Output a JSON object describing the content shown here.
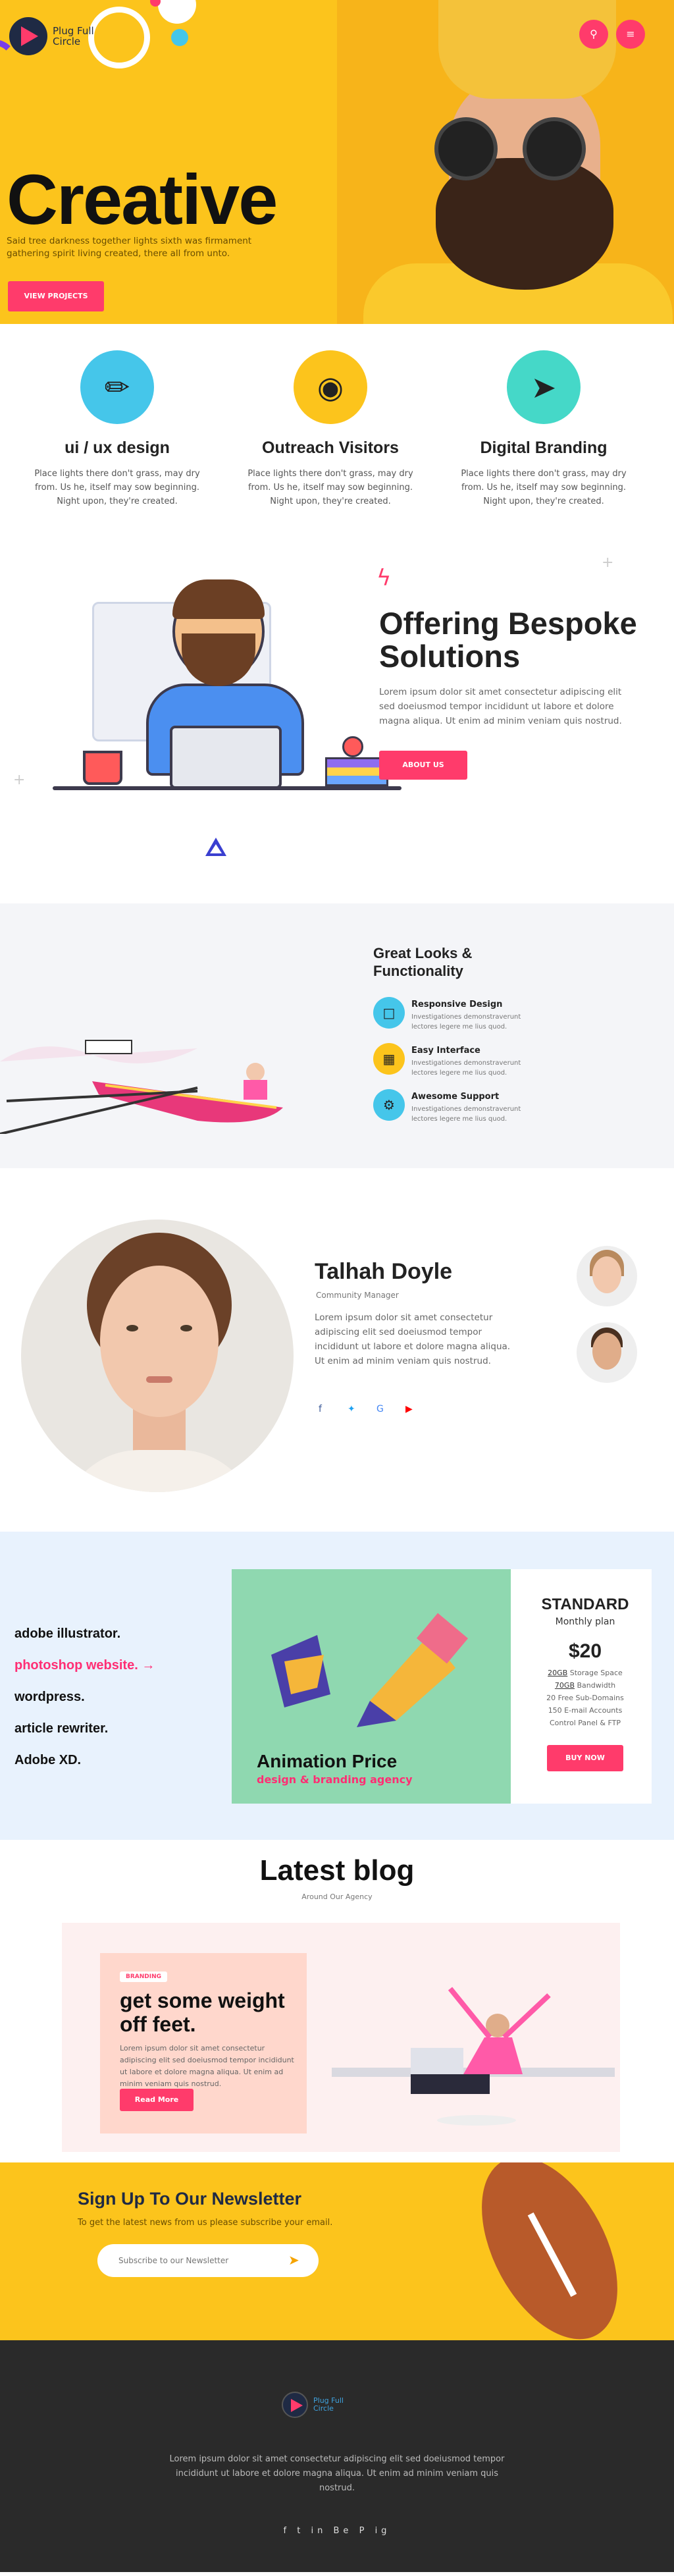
{
  "brand": {
    "name": "Plug Full Circle",
    "line1": "Plug Full",
    "line2": "Circle"
  },
  "colors": {
    "accent": "#ff3b6b",
    "yellow": "#fcc41c",
    "dark": "#2a2a2a"
  },
  "hero": {
    "title": "Creative",
    "subtitle": "Said tree darkness together lights sixth was firmament gathering spirit living created, there all from unto.",
    "button": "VIEW PROJECTS",
    "search_icon": "search-icon",
    "menu_icon": "menu-icon"
  },
  "services": [
    {
      "title": "ui / ux design",
      "text": "Place lights there don't grass, may dry from. Us he, itself may sow beginning. Night upon, they're created.",
      "icon": "brush-icon"
    },
    {
      "title": "Outreach Visitors",
      "text": "Place lights there don't grass, may dry from. Us he, itself may sow beginning. Night upon, they're created.",
      "icon": "camera-icon"
    },
    {
      "title": "Digital Branding",
      "text": "Place lights there don't grass, may dry from. Us he, itself may sow beginning. Night upon, they're created.",
      "icon": "paper-plane-icon"
    }
  ],
  "offering": {
    "title": "Offering Bespoke Solutions",
    "text": "Lorem ipsum dolor sit amet consectetur adipiscing elit sed doeiusmod tempor incididunt ut labore et dolore magna aliqua. Ut enim ad minim veniam quis nostrud.",
    "button": "ABOUT US"
  },
  "looks": {
    "title": "Great Looks & Functionality",
    "items": [
      {
        "title": "Responsive Design",
        "text": "Investigationes demonstraverunt lectores legere me lius quod.",
        "icon": "responsive-icon"
      },
      {
        "title": "Easy Interface",
        "text": "Investigationes demonstraverunt lectores legere me lius quod.",
        "icon": "interface-icon"
      },
      {
        "title": "Awesome Support",
        "text": "Investigationes demonstraverunt lectores legere me lius quod.",
        "icon": "support-icon"
      }
    ]
  },
  "team": {
    "name": "Talhah Doyle",
    "role": "Community Manager",
    "text": "Lorem ipsum dolor sit amet consectetur adipiscing elit sed doeiusmod tempor incididunt ut labore et dolore magna aliqua. Ut enim ad minim veniam quis nostrud.",
    "social": [
      "facebook-icon",
      "twitter-icon",
      "google-icon",
      "youtube-icon"
    ]
  },
  "pricing": {
    "list": [
      "adobe illustrator.",
      "photoshop website.",
      "wordpress.",
      "article rewriter.",
      "Adobe XD."
    ],
    "active_index": 1,
    "arrow": "→",
    "image_title": "Animation Price",
    "image_sub": "design & branding agency",
    "plan_name": "STANDARD",
    "plan_period": "Monthly plan",
    "price": "$20",
    "features": [
      {
        "bold": "20GB",
        "rest": " Storage Space"
      },
      {
        "bold": "70GB",
        "rest": " Bandwidth"
      },
      {
        "bold": "",
        "rest": "20 Free Sub-Domains"
      },
      {
        "bold": "",
        "rest": "150 E-mail Accounts"
      },
      {
        "bold": "",
        "rest": "Control Panel & FTP"
      }
    ],
    "button": "BUY NOW"
  },
  "blog": {
    "title": "Latest blog",
    "subtitle": "Around Our Agency",
    "tag": "BRANDING",
    "post_title": "get some weight off feet.",
    "post_text": "Lorem ipsum dolor sit amet consectetur adipiscing elit sed doeiusmod tempor incididunt ut labore et dolore magna aliqua. Ut enim ad minim veniam quis nostrud.",
    "button": "Read More"
  },
  "newsletter": {
    "title": "Sign Up To Our Newsletter",
    "text": "To get the latest news from us please subscribe your email.",
    "placeholder": "Subscribe to our Newsletter",
    "send_icon": "send-icon"
  },
  "footer": {
    "text": "Lorem ipsum dolor sit amet consectetur adipiscing elit sed doeiusmod tempor incididunt ut labore et dolore magna aliqua. Ut enim ad minim veniam quis nostrud.",
    "social": [
      "f",
      "t",
      "in",
      "Be",
      "P",
      "ig"
    ]
  }
}
